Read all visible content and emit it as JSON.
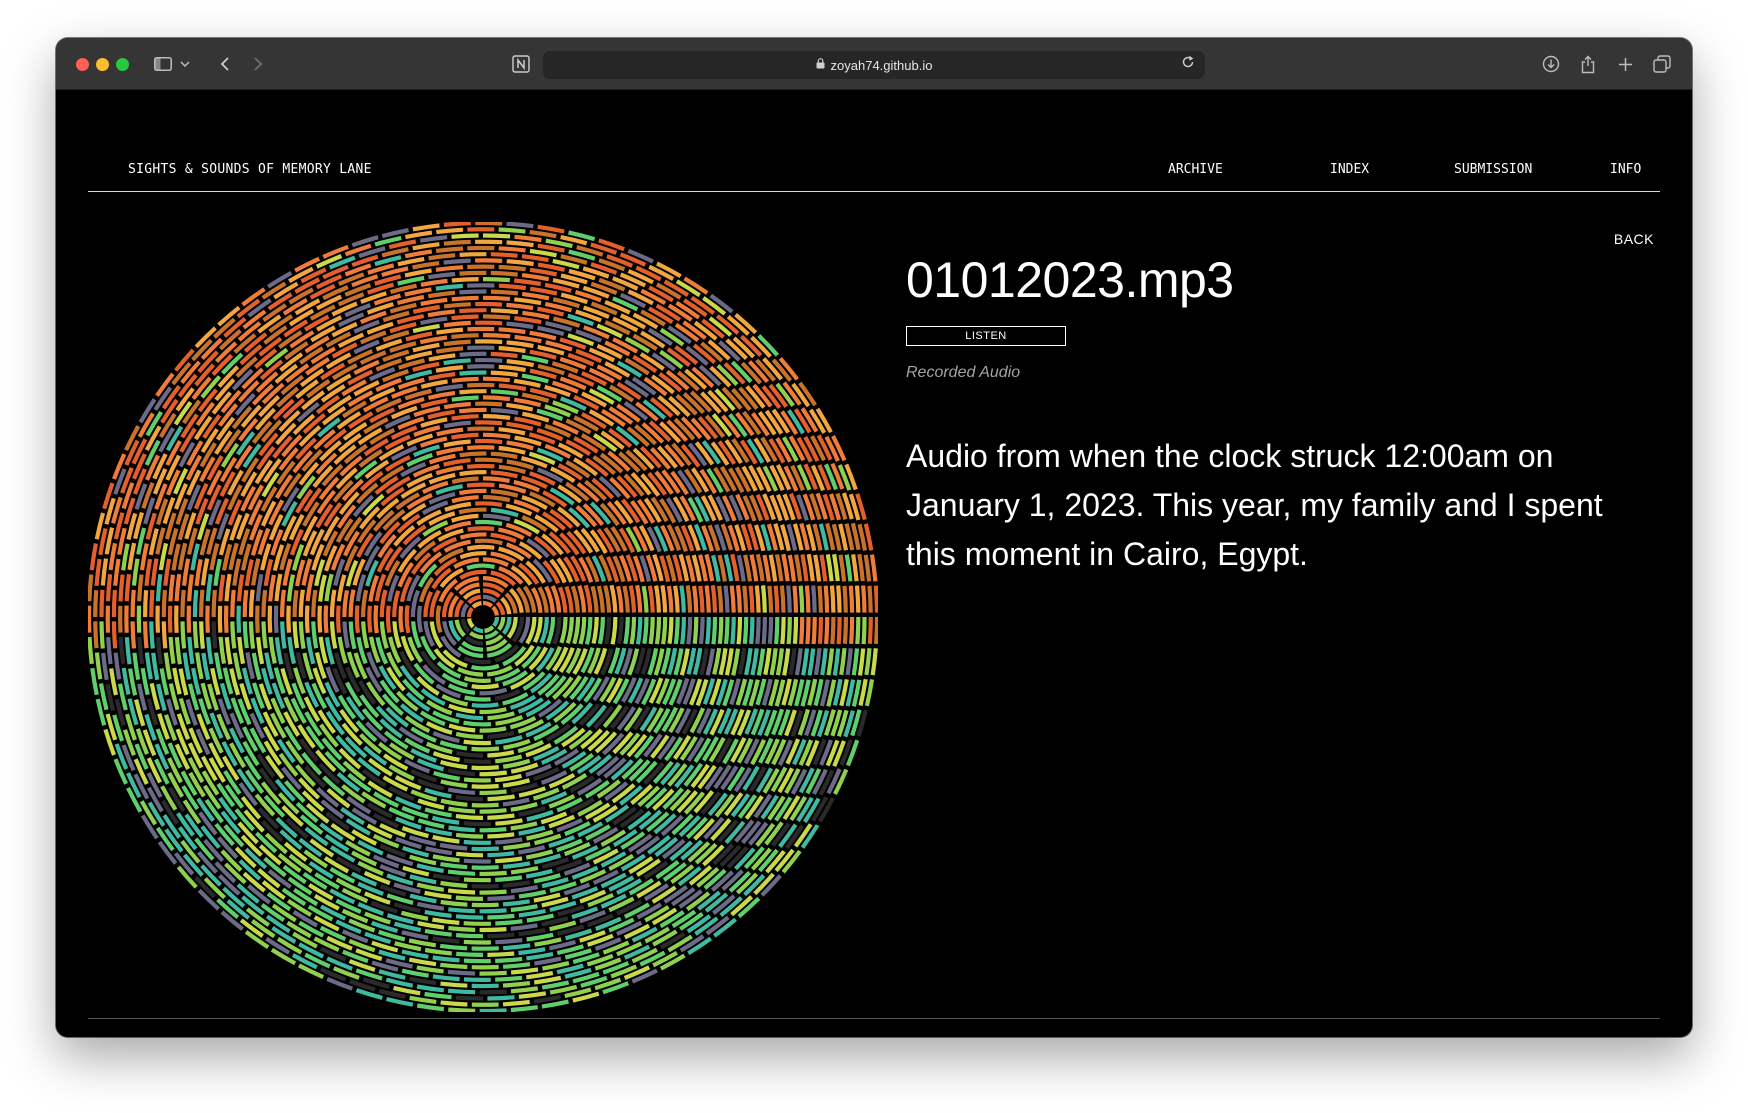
{
  "browser": {
    "url": "zoyah74.github.io",
    "icons": {
      "sidebar": "sidebar-icon",
      "chevron": "chevron-down-icon",
      "back": "back-arrow-icon",
      "forward": "forward-arrow-icon",
      "notion": "notion-icon",
      "lock": "lock-icon",
      "reload": "reload-icon",
      "download": "download-icon",
      "share": "share-icon",
      "new_tab": "plus-icon",
      "tabs": "tabs-overview-icon"
    }
  },
  "site": {
    "title": "SIGHTS & SOUNDS OF MEMORY LANE",
    "nav": [
      "ARCHIVE",
      "INDEX",
      "SUBMISSION",
      "INFO"
    ]
  },
  "entry": {
    "back_label": "BACK",
    "title": "01012023.mp3",
    "listen_label": "LISTEN",
    "meta": "Recorded Audio",
    "description": "Audio from when the clock struck 12:00am on January 1, 2023. This year, my family and I spent this moment in Cairo, Egypt."
  },
  "colors": {
    "background": "#000000",
    "text": "#ffffff",
    "muted": "#a4a4a4",
    "art_palette": [
      "#f07c3a",
      "#e35f2c",
      "#c8722c",
      "#f2a63f",
      "#8fd14f",
      "#5fcf6b",
      "#3fb9a0",
      "#6b6b88",
      "#c9d94a",
      "#2a2a2a"
    ]
  }
}
